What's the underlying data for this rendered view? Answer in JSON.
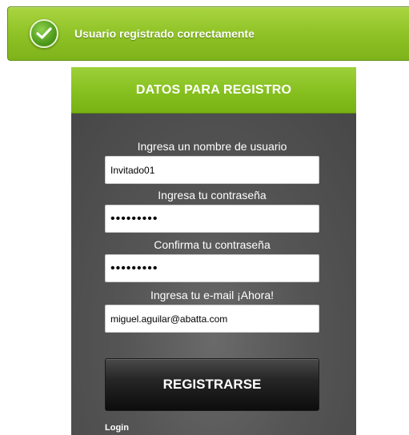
{
  "banner": {
    "icon": "check-circle-icon",
    "message": "Usuario registrado correctamente"
  },
  "form": {
    "title": "DATOS PARA REGISTRO",
    "fields": [
      {
        "label": "Ingresa un nombre de usuario",
        "value": "Invitado01",
        "type": "text"
      },
      {
        "label": "Ingresa tu contraseña",
        "value": "•••••••••",
        "type": "password"
      },
      {
        "label": "Confirma tu contraseña",
        "value": "•••••••••",
        "type": "password"
      },
      {
        "label": "Ingresa tu e-mail ¡Ahora!",
        "value": "miguel.aguilar@abatta.com",
        "type": "text"
      }
    ],
    "submit_label": "REGISTRARSE",
    "login_link": "Login"
  },
  "colors": {
    "accent_green": "#86c01f",
    "panel_gray": "#555555",
    "button_black": "#0c0c0c"
  }
}
